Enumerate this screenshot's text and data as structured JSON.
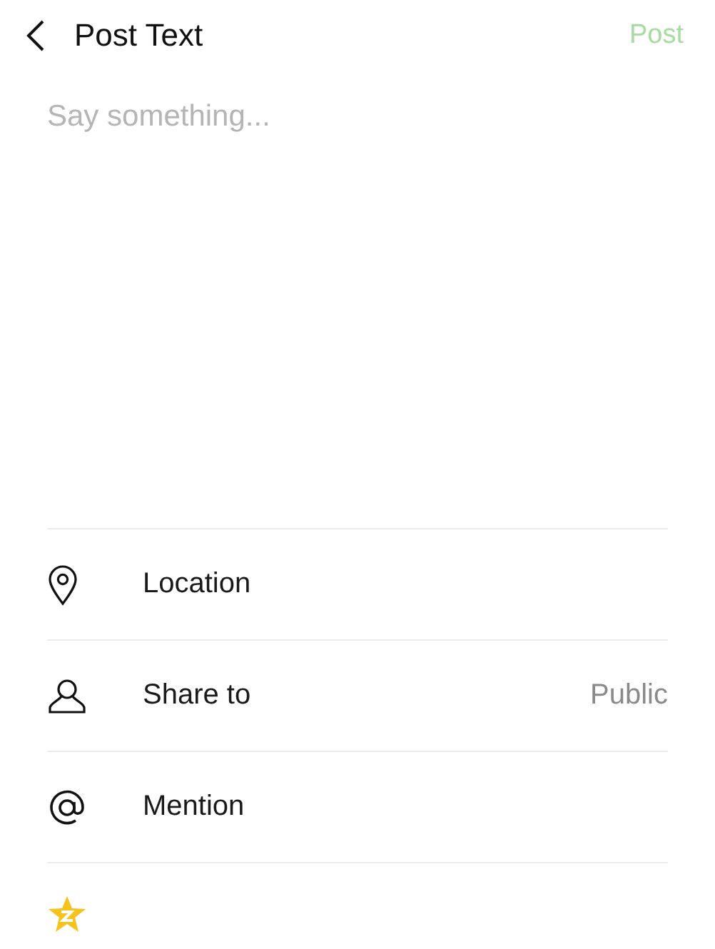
{
  "header": {
    "title": "Post Text",
    "post_button": {
      "label": "Post",
      "disabled": true
    }
  },
  "composer": {
    "placeholder": "Say something..."
  },
  "options": [
    {
      "kind": "location",
      "label": "Location"
    },
    {
      "kind": "share",
      "label": "Share to",
      "value": "Public"
    },
    {
      "kind": "mention",
      "label": "Mention"
    },
    {
      "kind": "star"
    }
  ]
}
